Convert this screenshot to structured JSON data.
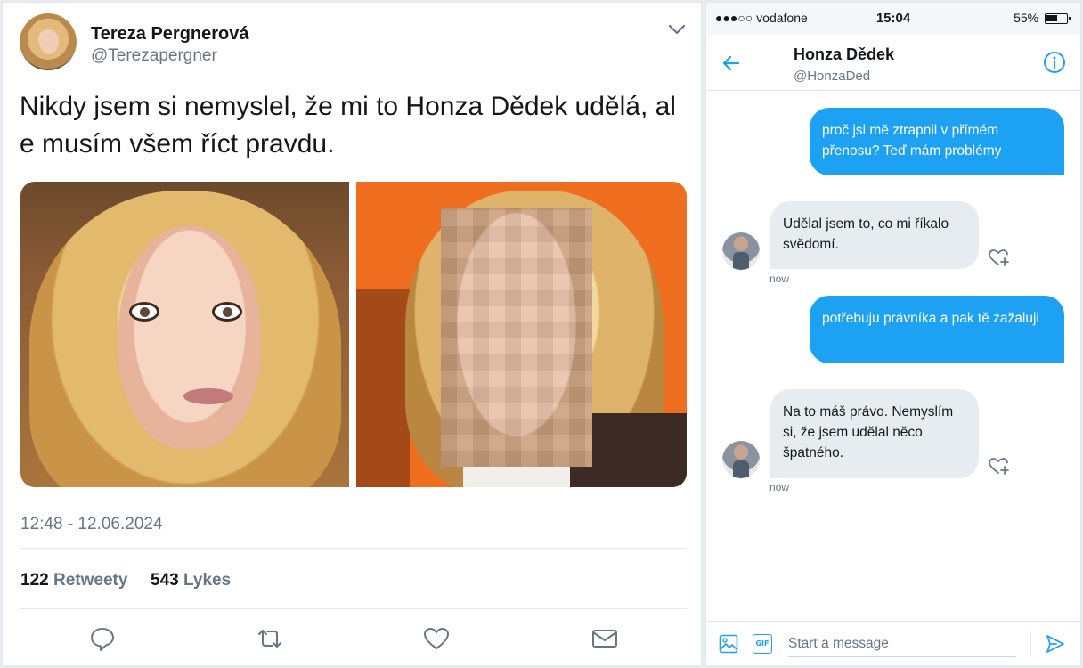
{
  "tweet": {
    "author_name": "Tereza Pergnerová",
    "author_handle": "@Terezapergner",
    "text": "Nikdy jsem si nemyslel, že mi to Honza Dědek udělá, al e musím všem říct pravdu.",
    "timestamp": "12:48 - 12.06.2024",
    "retweets_count": "122",
    "retweets_label": "Retweety",
    "likes_count": "543",
    "likes_label": "Lykes",
    "icons": {
      "menu": "chevron-down-icon",
      "reply": "reply-icon",
      "retweet": "retweet-icon",
      "like": "heart-icon",
      "dm": "envelope-icon"
    },
    "colors": {
      "accent": "#1da1f2",
      "secondary_text": "#657786"
    }
  },
  "dm": {
    "status_bar": {
      "carrier": "●●●○○ vodafone",
      "time": "15:04",
      "battery": "55%"
    },
    "header": {
      "name": "Honza Dědek",
      "handle": "@HonzaDed"
    },
    "messages": [
      {
        "from": "me",
        "text": "proč jsi mě ztrapnil v přímém přenosu? Teď mám problémy"
      },
      {
        "from": "them",
        "text": "Udělal jsem to, co mi říkalo svědomí.",
        "time": "now"
      },
      {
        "from": "me",
        "text": "potřebuju právníka a pak tě zažaluji"
      },
      {
        "from": "them",
        "text": "Na to máš právo. Nemyslím si, že jsem udělal něco špatného.",
        "time": "now"
      }
    ],
    "composer": {
      "placeholder": "Start a message",
      "gif_label": "GIF"
    },
    "colors": {
      "bubble_me": "#1da1f2",
      "bubble_them": "#e6ecf0"
    }
  }
}
